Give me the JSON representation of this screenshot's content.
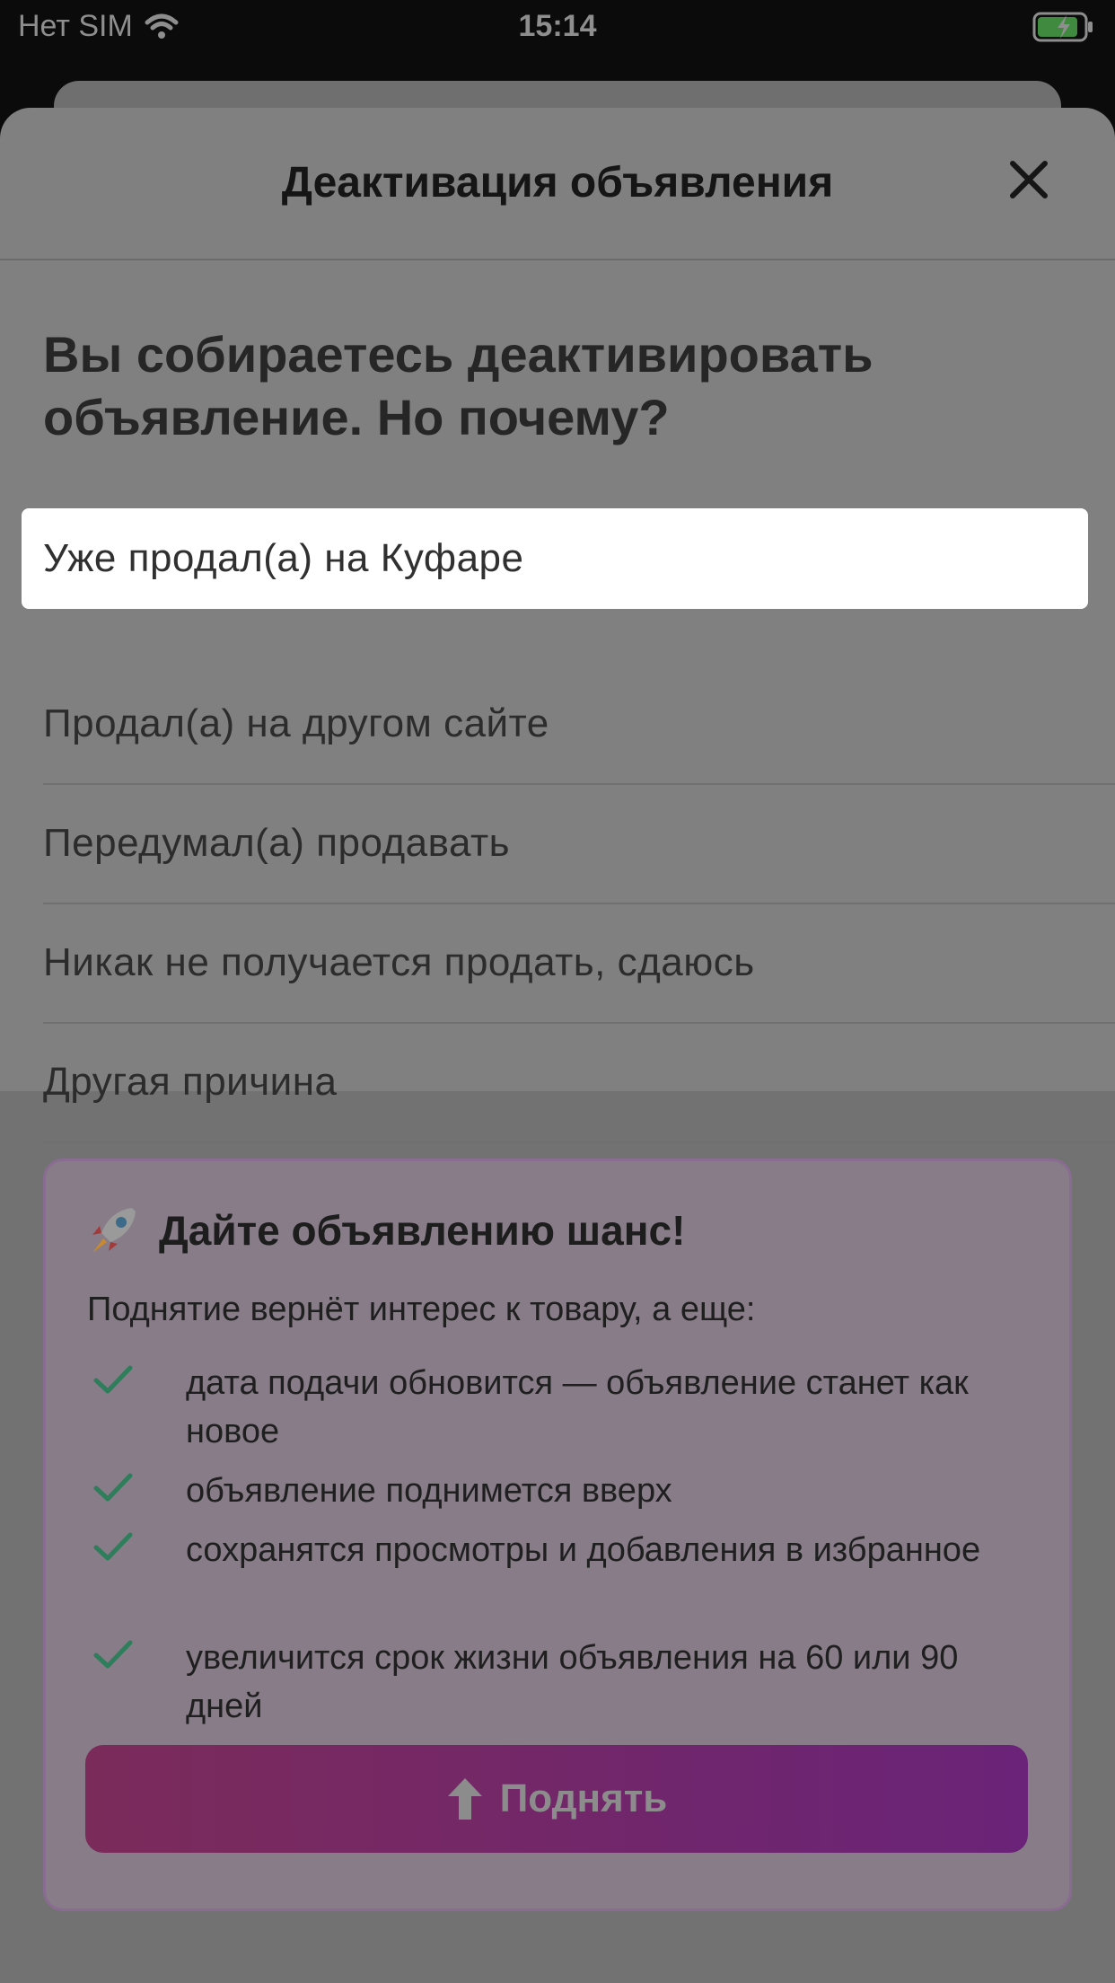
{
  "status_bar": {
    "carrier": "Нет SIM",
    "time": "15:14"
  },
  "sheet": {
    "title": "Деактивация объявления",
    "question": "Вы собираетесь деактивировать объявление. Но почему?",
    "options": [
      {
        "label": "Уже продал(а) на Куфаре",
        "selected": true
      },
      {
        "label": "Продал(а) на другом сайте",
        "selected": false
      },
      {
        "label": "Передумал(а) продавать",
        "selected": false
      },
      {
        "label": "Никак не получается продать, сдаюсь",
        "selected": false
      },
      {
        "label": "Другая причина",
        "selected": false
      }
    ]
  },
  "promo": {
    "title": "Дайте объявлению шанс!",
    "subtitle": "Поднятие вернёт интерес к товару, а еще:",
    "benefits": [
      "дата подачи обновится — объявление станет как новое",
      "объявление поднимется вверх",
      "сохранятся просмотры и добавления в избранное",
      "увеличится срок жизни объявления на 60 или 90 дней"
    ],
    "button_label": "Поднять"
  },
  "colors": {
    "check": "#2e7d5b",
    "button_gradient_start": "#7b2b5a",
    "button_gradient_end": "#6a2378",
    "promo_border": "#8a6b91"
  },
  "icons": [
    "wifi-icon",
    "battery-charging-icon",
    "close-icon",
    "rocket-icon",
    "check-icon",
    "arrow-up-icon"
  ]
}
